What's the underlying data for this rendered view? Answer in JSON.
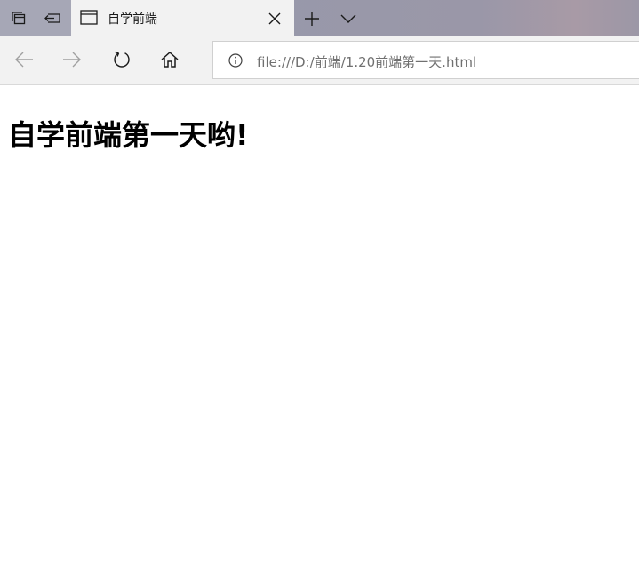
{
  "browser": {
    "tab": {
      "title": "自学前端"
    },
    "address_bar": {
      "url": "file:///D:/前端/1.20前端第一天.html"
    }
  },
  "page": {
    "heading": "自学前端第一天哟!"
  }
}
